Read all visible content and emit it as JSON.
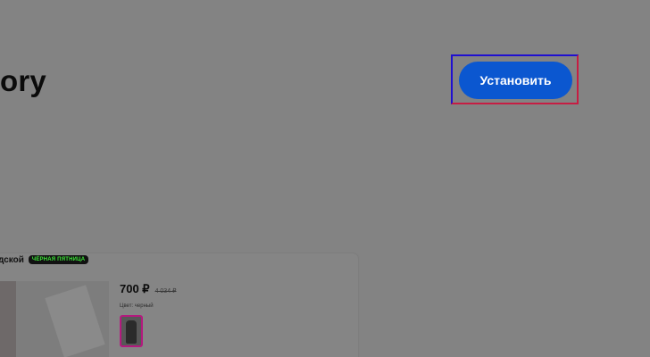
{
  "header": {
    "title": "ory",
    "install_label": "Установить"
  },
  "product_card": {
    "seller": "дской",
    "badge": "ЧЁРНАЯ ПЯТНИЦА",
    "price": "700 ₽",
    "old_price": "4 034 ₽",
    "color_label": "Цвет: черный"
  },
  "colors": {
    "overlay_background": "#838383",
    "install_button": "#0b57d0",
    "highlight_outer_top": "#1f0fd0",
    "highlight_outer_bottom": "#c61d43",
    "badge_text": "#3ee83a",
    "swatch_border": "#b31a7e"
  }
}
